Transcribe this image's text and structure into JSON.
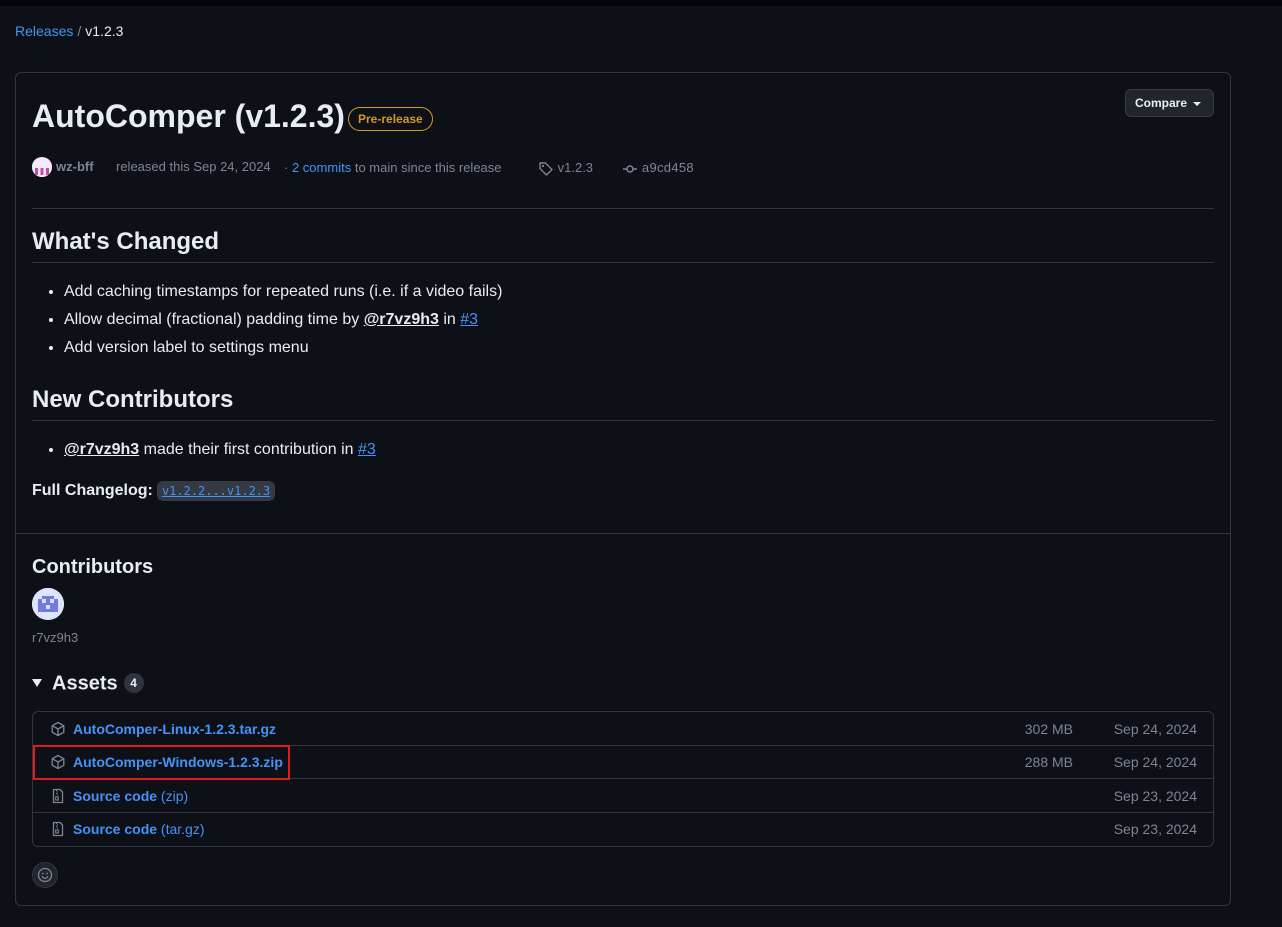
{
  "breadcrumb": {
    "releases_label": "Releases",
    "separator": "/",
    "current": "v1.2.3"
  },
  "release": {
    "title": "AutoComper (v1.2.3)",
    "badge": "Pre-release",
    "compare_label": "Compare",
    "author": "wz-bff",
    "released_text": "released this Sep 24, 2024",
    "commits_prefix": "·",
    "commits_link": "2 commits",
    "commits_suffix": "to main since this release",
    "tag": "v1.2.3",
    "commit_sha": "a9cd458"
  },
  "whats_changed": {
    "heading": "What's Changed",
    "items": [
      {
        "text": "Add caching timestamps for repeated runs (i.e. if a video fails)"
      },
      {
        "text_before": "Allow decimal (fractional) padding time by",
        "user": "@r7vz9h3",
        "text_mid": "in",
        "issue": "#3"
      },
      {
        "text": "Add version label to settings menu"
      }
    ]
  },
  "new_contributors": {
    "heading": "New Contributors",
    "user": "@r7vz9h3",
    "text": "made their first contribution in",
    "issue": "#3"
  },
  "changelog": {
    "label": "Full Changelog:",
    "range": "v1.2.2...v1.2.3"
  },
  "contributors": {
    "heading": "Contributors",
    "names": [
      "r7vz9h3"
    ]
  },
  "assets": {
    "heading": "Assets",
    "count": "4",
    "rows": [
      {
        "name": "AutoComper-Linux-1.2.3.tar.gz",
        "suffix": "",
        "size": "302 MB",
        "date": "Sep 24, 2024",
        "icon": "package-icon"
      },
      {
        "name": "AutoComper-Windows-1.2.3.zip",
        "suffix": "",
        "size": "288 MB",
        "date": "Sep 24, 2024",
        "icon": "package-icon"
      },
      {
        "name": "Source code",
        "suffix": "(zip)",
        "size": "",
        "date": "Sep 23, 2024",
        "icon": "file-zip-icon"
      },
      {
        "name": "Source code",
        "suffix": "(tar.gz)",
        "size": "",
        "date": "Sep 23, 2024",
        "icon": "file-zip-icon"
      }
    ]
  },
  "colors": {
    "link": "#4493f8",
    "badge": "#d29922",
    "highlight": "#e01b1b",
    "bg": "#0d1117",
    "border": "#30363d"
  }
}
